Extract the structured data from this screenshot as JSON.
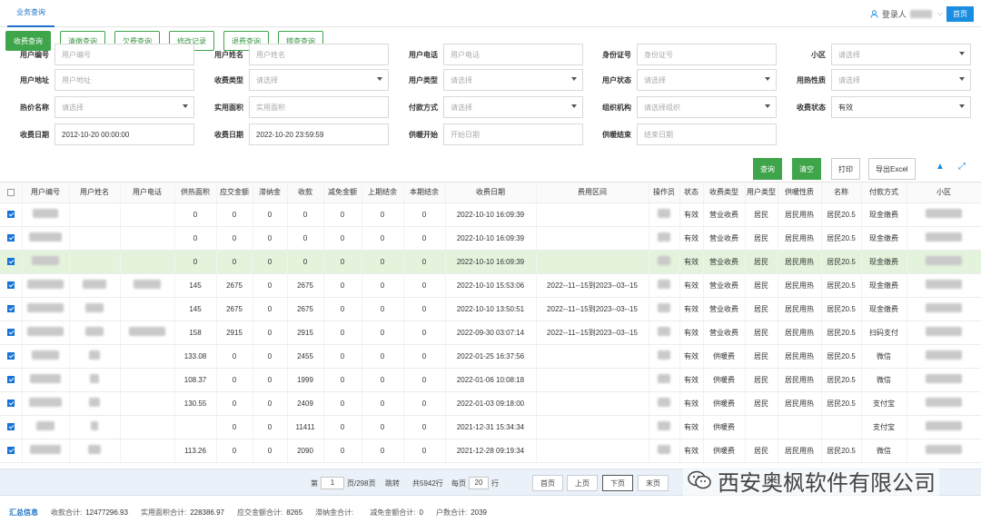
{
  "header": {
    "tab": "业务查询",
    "login_label": "登录人",
    "home_label": "首页"
  },
  "tabs": [
    {
      "label": "收费查询",
      "active": true
    },
    {
      "label": "清缴查询"
    },
    {
      "label": "欠费查询"
    },
    {
      "label": "修改记录"
    },
    {
      "label": "退费查询"
    },
    {
      "label": "稽查查询"
    }
  ],
  "form": {
    "rows": [
      [
        {
          "label": "用户编号",
          "placeholder": "用户编号"
        },
        {
          "label": "用户姓名",
          "placeholder": "用户姓名"
        },
        {
          "label": "用户电话",
          "placeholder": "用户电话"
        },
        {
          "label": "身份证号",
          "placeholder": "身份证号"
        },
        {
          "label": "小区",
          "placeholder": "请选择",
          "select": true
        }
      ],
      [
        {
          "label": "用户地址",
          "placeholder": "用户地址"
        },
        {
          "label": "收费类型",
          "placeholder": "请选择",
          "select": true
        },
        {
          "label": "用户类型",
          "placeholder": "请选择",
          "select": true
        },
        {
          "label": "用户状态",
          "placeholder": "请选择",
          "select": true
        },
        {
          "label": "用热性质",
          "placeholder": "请选择",
          "select": true
        }
      ],
      [
        {
          "label": "热价名称",
          "placeholder": "请选择",
          "select": true
        },
        {
          "label": "实用面积",
          "placeholder": "实用面积"
        },
        {
          "label": "付款方式",
          "placeholder": "请选择",
          "select": true
        },
        {
          "label": "组织机构",
          "placeholder": "请选择组织",
          "select": true
        },
        {
          "label": "收费状态",
          "value": "有效",
          "select": true
        }
      ],
      [
        {
          "label": "收费日期",
          "value": "2012-10-20 00:00:00"
        },
        {
          "label": "收费日期",
          "value": "2022-10-20 23:59:59"
        },
        {
          "label": "供暖开始",
          "placeholder": "开始日期"
        },
        {
          "label": "供暖结束",
          "placeholder": "结束日期"
        }
      ]
    ]
  },
  "actions": {
    "query": "查询",
    "clear": "清空",
    "print": "打印",
    "export": "导出Excel"
  },
  "table": {
    "columns": [
      "用户编号",
      "用户姓名",
      "用户电话",
      "供热面积",
      "应交金额",
      "滞纳金",
      "收款",
      "减免金额",
      "上期结余",
      "本期结余",
      "收费日期",
      "费用区间",
      "操作员",
      "状态",
      "收费类型",
      "用户类型",
      "供暖性质",
      "名称",
      "付款方式",
      "小区"
    ],
    "rows": [
      {
        "checked": true,
        "area": "0",
        "due": "0",
        "late": "0",
        "paid": "0",
        "reduce": "0",
        "prev": "0",
        "cur": "0",
        "date": "2022-10-10 16:09:39",
        "range": "",
        "status": "有效",
        "type": "营业收费",
        "utype": "居民",
        "nature": "居民用热",
        "name": "居民20.5",
        "pay": "现金缴费"
      },
      {
        "checked": true,
        "area": "0",
        "due": "0",
        "late": "0",
        "paid": "0",
        "reduce": "0",
        "prev": "0",
        "cur": "0",
        "date": "2022-10-10 16:09:39",
        "range": "",
        "status": "有效",
        "type": "营业收费",
        "utype": "居民",
        "nature": "居民用热",
        "name": "居民20.5",
        "pay": "现金缴费"
      },
      {
        "checked": true,
        "hl": true,
        "area": "0",
        "due": "0",
        "late": "0",
        "paid": "0",
        "reduce": "0",
        "prev": "0",
        "cur": "0",
        "date": "2022-10-10 16:09:39",
        "range": "",
        "status": "有效",
        "type": "营业收费",
        "utype": "居民",
        "nature": "居民用热",
        "name": "居民20.5",
        "pay": "现金缴费"
      },
      {
        "checked": true,
        "area": "145",
        "due": "2675",
        "late": "0",
        "paid": "2675",
        "reduce": "0",
        "prev": "0",
        "cur": "0",
        "date": "2022-10-10 15:53:06",
        "range": "2022--11--15到2023--03--15",
        "status": "有效",
        "type": "营业收费",
        "utype": "居民",
        "nature": "居民用热",
        "name": "居民20.5",
        "pay": "现金缴费"
      },
      {
        "checked": true,
        "area": "145",
        "due": "2675",
        "late": "0",
        "paid": "2675",
        "reduce": "0",
        "prev": "0",
        "cur": "0",
        "date": "2022-10-10 13:50:51",
        "range": "2022--11--15到2023--03--15",
        "status": "有效",
        "type": "营业收费",
        "utype": "居民",
        "nature": "居民用热",
        "name": "居民20.5",
        "pay": "现金缴费"
      },
      {
        "checked": true,
        "area": "158",
        "due": "2915",
        "late": "0",
        "paid": "2915",
        "reduce": "0",
        "prev": "0",
        "cur": "0",
        "date": "2022-09-30 03:07:14",
        "range": "2022--11--15到2023--03--15",
        "status": "有效",
        "type": "营业收费",
        "utype": "居民",
        "nature": "居民用热",
        "name": "居民20.5",
        "pay": "扫码支付"
      },
      {
        "checked": true,
        "area": "133.08",
        "due": "0",
        "late": "0",
        "paid": "2455",
        "reduce": "0",
        "prev": "0",
        "cur": "0",
        "date": "2022-01-25 16:37:56",
        "range": "",
        "status": "有效",
        "type": "供暖费",
        "utype": "居民",
        "nature": "居民用热",
        "name": "居民20.5",
        "pay": "微信"
      },
      {
        "checked": true,
        "area": "108.37",
        "due": "0",
        "late": "0",
        "paid": "1999",
        "reduce": "0",
        "prev": "0",
        "cur": "0",
        "date": "2022-01-06 10:08:18",
        "range": "",
        "status": "有效",
        "type": "供暖费",
        "utype": "居民",
        "nature": "居民用热",
        "name": "居民20.5",
        "pay": "微信"
      },
      {
        "checked": true,
        "area": "130.55",
        "due": "0",
        "late": "0",
        "paid": "2409",
        "reduce": "0",
        "prev": "0",
        "cur": "0",
        "date": "2022-01-03 09:18:00",
        "range": "",
        "status": "有效",
        "type": "供暖费",
        "utype": "居民",
        "nature": "居民用热",
        "name": "居民20.5",
        "pay": "支付宝"
      },
      {
        "checked": true,
        "area": "",
        "due": "0",
        "late": "0",
        "paid": "11411",
        "reduce": "0",
        "prev": "0",
        "cur": "0",
        "date": "2021-12-31 15:34:34",
        "range": "",
        "status": "有效",
        "type": "供暖费",
        "utype": "",
        "nature": "",
        "name": "",
        "pay": "支付宝"
      },
      {
        "checked": true,
        "area": "113.26",
        "due": "0",
        "late": "0",
        "paid": "2090",
        "reduce": "0",
        "prev": "0",
        "cur": "0",
        "date": "2021-12-28 09:19:34",
        "range": "",
        "status": "有效",
        "type": "供暖费",
        "utype": "居民",
        "nature": "居民用热",
        "name": "居民20.5",
        "pay": "微信"
      }
    ]
  },
  "pager": {
    "prefix": "第",
    "page": "1",
    "of": "页/298页",
    "jump": "跳转",
    "total": "共5942行",
    "per_prefix": "每页",
    "per": "20",
    "per_suffix": "行",
    "first": "首页",
    "prev": "上页",
    "next": "下页",
    "last": "末页"
  },
  "watermark": "西安奥枫软件有限公司",
  "summary": {
    "title": "汇总信息",
    "items": [
      {
        "label": "收款合计:",
        "value": "12477296.93"
      },
      {
        "label": "实用面积合计:",
        "value": "228386.97"
      },
      {
        "label": "应交金额合计:",
        "value": "8265"
      },
      {
        "label": "滞纳金合计:",
        "value": ""
      },
      {
        "label": "减免金额合计:",
        "value": "0"
      },
      {
        "label": "户数合计:",
        "value": "2039"
      }
    ]
  }
}
